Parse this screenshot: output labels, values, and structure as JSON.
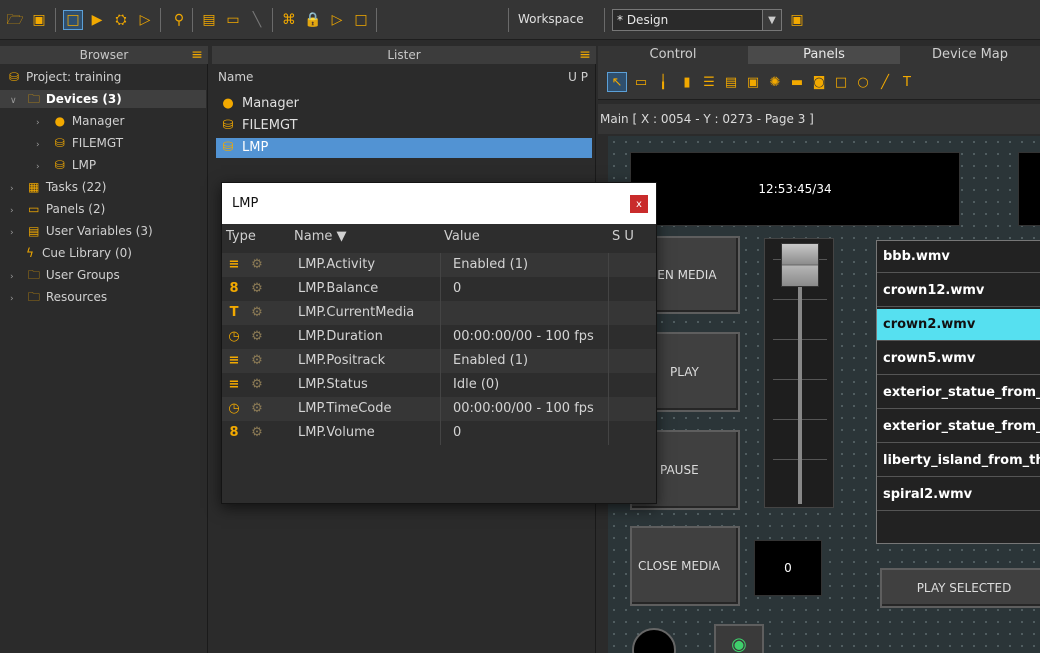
{
  "toolbar": {
    "workspace_label": "Workspace",
    "workspace_value": "* Design"
  },
  "panels": {
    "browser_title": "Browser",
    "lister_title": "Lister"
  },
  "tabs": [
    "Control",
    "Panels",
    "Device Map"
  ],
  "browser": {
    "items": [
      {
        "label": "Project: training",
        "icon": "project-icon"
      },
      {
        "label": "Devices (3)",
        "icon": "devices-folder-icon"
      },
      {
        "label": "Manager",
        "icon": "manager-device-icon"
      },
      {
        "label": "FILEMGT",
        "icon": "filemgt-device-icon"
      },
      {
        "label": "LMP",
        "icon": "lmp-device-icon"
      },
      {
        "label": "Tasks (22)",
        "icon": "tasks-icon"
      },
      {
        "label": "Panels (2)",
        "icon": "panels-icon"
      },
      {
        "label": "User Variables (3)",
        "icon": "user-variables-icon"
      },
      {
        "label": "Cue Library (0)",
        "icon": "cue-library-icon"
      },
      {
        "label": "User Groups",
        "icon": "folder-icon"
      },
      {
        "label": "Resources",
        "icon": "folder-icon"
      }
    ]
  },
  "lister": {
    "col_name": "Name",
    "col_up": "U P",
    "rows": [
      "Manager",
      "FILEMGT",
      "LMP"
    ]
  },
  "canvas": {
    "title": "Main [ X : 0054 - Y : 0273 - Page 3 ]",
    "clock": "12:53:45/34",
    "buttons": [
      "PEN MEDIA",
      "PLAY",
      "PAUSE",
      "CLOSE MEDIA"
    ],
    "counter": "0",
    "play_selected": "PLAY SELECTED",
    "media": [
      "bbb.wmv",
      "crown12.wmv",
      "crown2.wmv",
      "crown5.wmv",
      "exterior_statue_from_",
      "exterior_statue_from_",
      "liberty_island_from_th",
      "spiral2.wmv"
    ],
    "selected_media_index": 2
  },
  "dialog": {
    "title": "LMP",
    "close": "x",
    "col_type": "Type",
    "col_name": "Name ▼",
    "col_value": "Value",
    "col_su": "S U",
    "rows": [
      {
        "type": "≡",
        "name": "LMP.Activity",
        "value": "Enabled (1)"
      },
      {
        "type": "8",
        "name": "LMP.Balance",
        "value": "0"
      },
      {
        "type": "T",
        "name": "LMP.CurrentMedia",
        "value": ""
      },
      {
        "type": "◷",
        "name": "LMP.Duration",
        "value": "00:00:00/00 - 100 fps"
      },
      {
        "type": "≡",
        "name": "LMP.Positrack",
        "value": "Enabled (1)"
      },
      {
        "type": "≡",
        "name": "LMP.Status",
        "value": "Idle (0)"
      },
      {
        "type": "◷",
        "name": "LMP.TimeCode",
        "value": "00:00:00/00 - 100 fps"
      },
      {
        "type": "8",
        "name": "LMP.Volume",
        "value": "0"
      }
    ]
  }
}
